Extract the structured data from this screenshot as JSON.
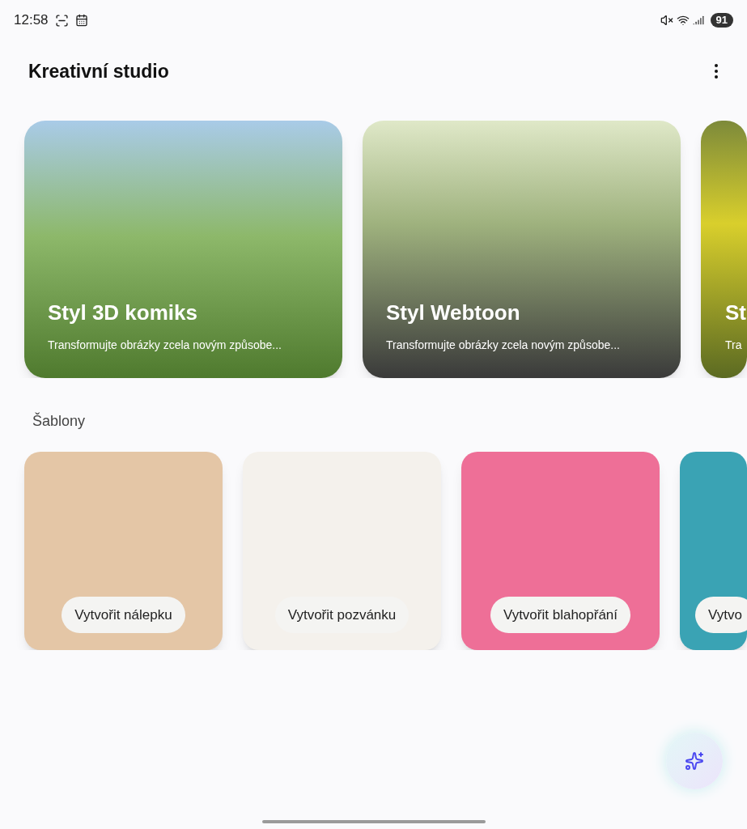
{
  "status_bar": {
    "time": "12:58",
    "battery": "91"
  },
  "header": {
    "title": "Kreativní studio"
  },
  "styles": [
    {
      "title": "Styl 3D komiks",
      "subtitle": "Transformujte obrázky zcela novým způsobe...",
      "kind": "full"
    },
    {
      "title": "Styl Webtoon",
      "subtitle": "Transformujte obrázky zcela novým způsobe...",
      "kind": "full"
    },
    {
      "title": "St",
      "subtitle": "Tra",
      "kind": "partial"
    }
  ],
  "templates_heading": "Šablony",
  "templates": [
    {
      "label": "Vytvořit nálepku",
      "kind": "full"
    },
    {
      "label": "Vytvořit pozvánku",
      "kind": "full"
    },
    {
      "label": "Vytvořit blahopřání",
      "kind": "full"
    },
    {
      "label": "Vytvo",
      "kind": "partial"
    }
  ]
}
